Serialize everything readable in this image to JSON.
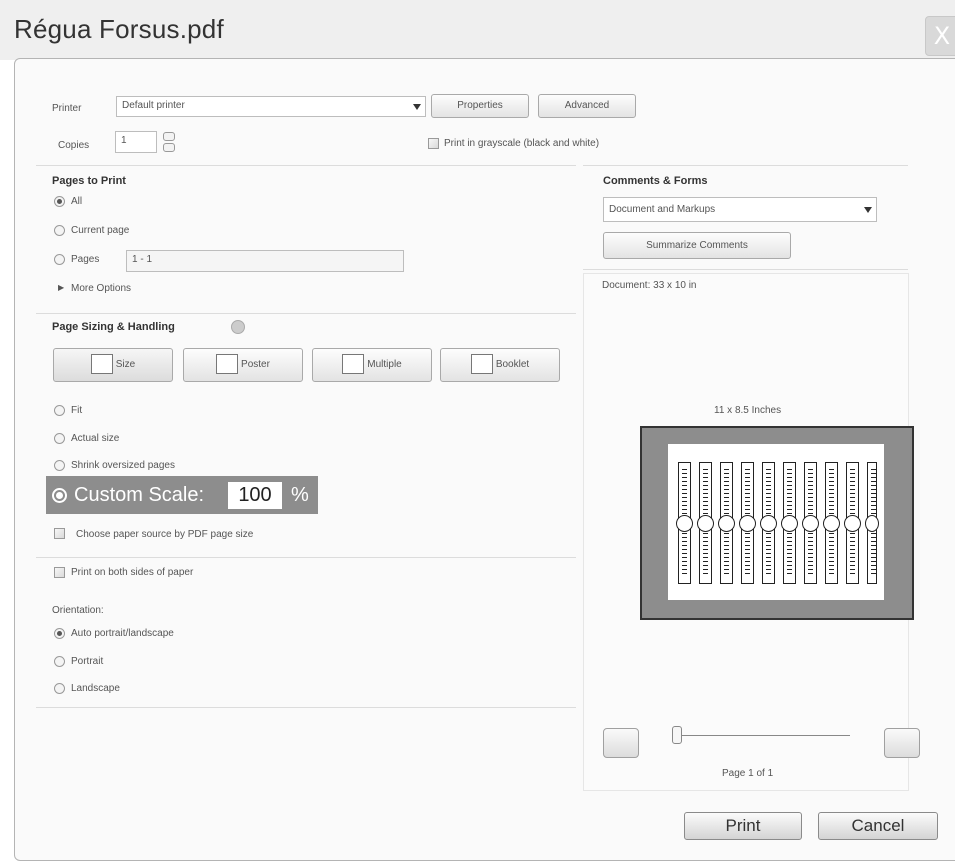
{
  "window": {
    "title": "Régua Forsus.pdf",
    "close_label": "X"
  },
  "printer": {
    "label": "Printer",
    "selected": "Default printer",
    "properties_label": "Properties",
    "advanced_label": "Advanced",
    "copies_label": "Copies",
    "copies_value": "1",
    "grayscale_label": "Print in grayscale (black and white)"
  },
  "pages_to_print": {
    "heading": "Pages to Print",
    "all_label": "All",
    "current_label": "Current page",
    "pages_label": "Pages",
    "pages_value": "1 - 1",
    "more_options_label": "More Options"
  },
  "sizing": {
    "heading": "Page Sizing & Handling",
    "modes": [
      "Size",
      "Poster",
      "Multiple",
      "Booklet"
    ],
    "fit_label": "Fit",
    "actual_size_label": "Actual size",
    "shrink_label": "Shrink oversized pages",
    "custom_scale_label": "Custom Scale:",
    "custom_scale_value": "100",
    "custom_scale_unit": "%",
    "paper_source_label": "Choose paper source by PDF page size"
  },
  "duplex": {
    "label": "Print on both sides of paper"
  },
  "orientation": {
    "heading": "Orientation:",
    "auto_label": "Auto portrait/landscape",
    "portrait_label": "Portrait",
    "landscape_label": "Landscape"
  },
  "comments_forms": {
    "heading": "Comments & Forms",
    "selected": "Document and Markups",
    "summarize_label": "Summarize Comments"
  },
  "preview": {
    "doc_info": "Document: 33 x 10 in",
    "paper_info": "11 x 8.5 Inches",
    "page_info": "Page 1 of 1"
  },
  "actions": {
    "print_label": "Print",
    "cancel_label": "Cancel"
  }
}
